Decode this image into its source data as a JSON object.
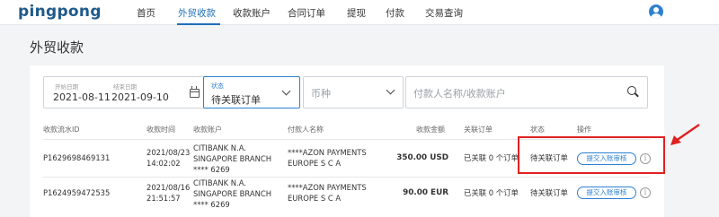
{
  "app": {
    "logo": "pingpong"
  },
  "nav": {
    "items": [
      {
        "label": "首页"
      },
      {
        "label": "外贸收款"
      },
      {
        "label": "收款账户"
      },
      {
        "label": "合同订单"
      },
      {
        "label": "提现"
      },
      {
        "label": "付款"
      },
      {
        "label": "交易查询"
      }
    ],
    "active_index": 1
  },
  "page": {
    "title": "外贸收款"
  },
  "filters": {
    "start_date_label": "开始日期",
    "start_date": "2021-08-11",
    "end_date_label": "结束日期",
    "end_date": "2021-09-10",
    "status_label": "状态",
    "status_value": "待关联订单",
    "currency_placeholder": "币种",
    "search_placeholder": "付款人名称/收款账户"
  },
  "table": {
    "columns": [
      "收款流水ID",
      "收款时间",
      "收款账户",
      "付款人名称",
      "收款金额",
      "关联订单",
      "状态",
      "操作"
    ],
    "rows": [
      {
        "id": "P1629698469131",
        "date": "2021/08/23",
        "time": "14:02:02",
        "account_line1": "CITIBANK N.A.",
        "account_line2": "SINGAPORE BRANCH",
        "account_line3": "**** 6269",
        "payer_line1": "****AZON PAYMENTS",
        "payer_line2": "EUROPE S C A",
        "amount": "350.00 USD",
        "linked": "已关联 0 个订单",
        "status": "待关联订单",
        "action": "提交入账审核"
      },
      {
        "id": "P1624959472535",
        "date": "2021/08/16",
        "time": "21:51:57",
        "account_line1": "CITIBANK N.A.",
        "account_line2": "SINGAPORE BRANCH",
        "account_line3": "**** 6269",
        "payer_line1": "****AZON PAYMENTS",
        "payer_line2": "EUROPE S C A",
        "amount": "90.00 EUR",
        "linked": "已关联 0 个订单",
        "status": "待关联订单",
        "action": "提交入账审核"
      }
    ]
  },
  "colors": {
    "brand": "#1e5a8a",
    "accent": "#2f80d1",
    "annotation": "#e02020"
  },
  "icons": [
    "avatar-icon",
    "calendar-icon",
    "chevron-down-icon",
    "search-icon",
    "info-icon",
    "arrow-icon"
  ]
}
